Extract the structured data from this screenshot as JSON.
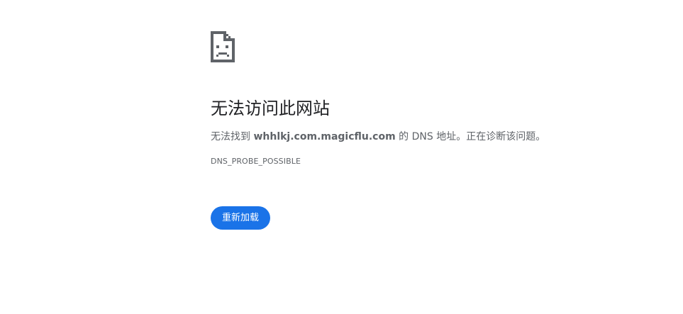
{
  "error": {
    "icon": "sad-page-icon",
    "title": "无法访问此网站",
    "summary_prefix": "无法找到 ",
    "host": "whhlkj.com.magicflu.com",
    "summary_suffix": " 的 DNS 地址。正在诊断该问题。",
    "code": "DNS_PROBE_POSSIBLE"
  },
  "actions": {
    "reload_label": "重新加载"
  },
  "colors": {
    "background": "#ffffff",
    "title": "#202124",
    "text": "#5f6368",
    "icon": "#5f6368",
    "button": "#1a73e8",
    "button_text": "#ffffff"
  }
}
